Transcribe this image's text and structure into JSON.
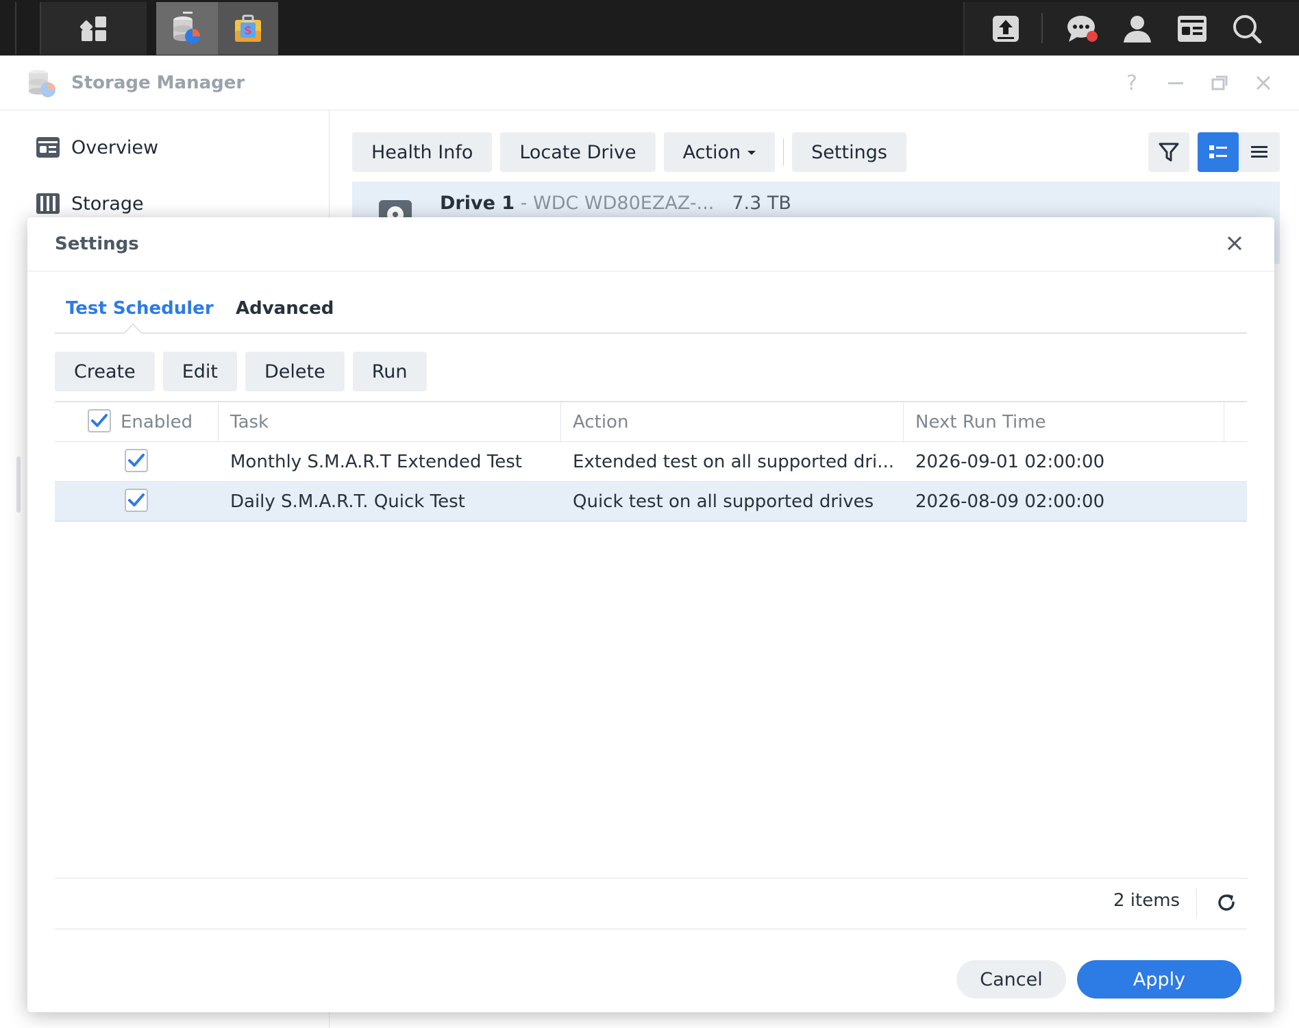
{
  "taskbar": {
    "icons": [
      "main-menu-icon",
      "storage-manager-app-icon",
      "package-center-app-icon",
      "upload-icon",
      "chat-notification-icon",
      "user-icon",
      "widgets-icon",
      "search-icon"
    ],
    "notification_color": "#e8423f"
  },
  "window": {
    "title": "Storage Manager",
    "help_label": "?"
  },
  "sidebar": {
    "items": [
      {
        "label": "Overview",
        "icon": "overview-icon"
      },
      {
        "label": "Storage",
        "icon": "storage-icon"
      }
    ]
  },
  "toolbar": {
    "health_info": "Health Info",
    "locate_drive": "Locate Drive",
    "action": "Action",
    "settings": "Settings"
  },
  "drive": {
    "name": "Drive 1",
    "model": " - WDC WD80EZAZ-...",
    "size": "7.3 TB"
  },
  "dialog": {
    "title": "Settings",
    "tabs": [
      {
        "label": "Test Scheduler",
        "active": true
      },
      {
        "label": "Advanced",
        "active": false
      }
    ],
    "buttons": {
      "create": "Create",
      "edit": "Edit",
      "delete": "Delete",
      "run": "Run"
    },
    "columns": {
      "enabled": "Enabled",
      "task": "Task",
      "action": "Action",
      "next_run": "Next Run Time"
    },
    "rows": [
      {
        "enabled": true,
        "task": "Monthly S.M.A.R.T Extended Test",
        "action": "Extended test on all supported dri...",
        "next_run": "2026-09-01 02:00:00",
        "selected": false
      },
      {
        "enabled": true,
        "task": "Daily S.M.A.R.T. Quick Test",
        "action": "Quick test on all supported drives",
        "next_run": "2026-08-09 02:00:00",
        "selected": true
      }
    ],
    "footer": {
      "count": "2 items"
    },
    "cancel": "Cancel",
    "apply": "Apply"
  },
  "colors": {
    "accent": "#2d7be5",
    "selected_row": "#e6eef8",
    "button_bg": "#eceff2"
  }
}
